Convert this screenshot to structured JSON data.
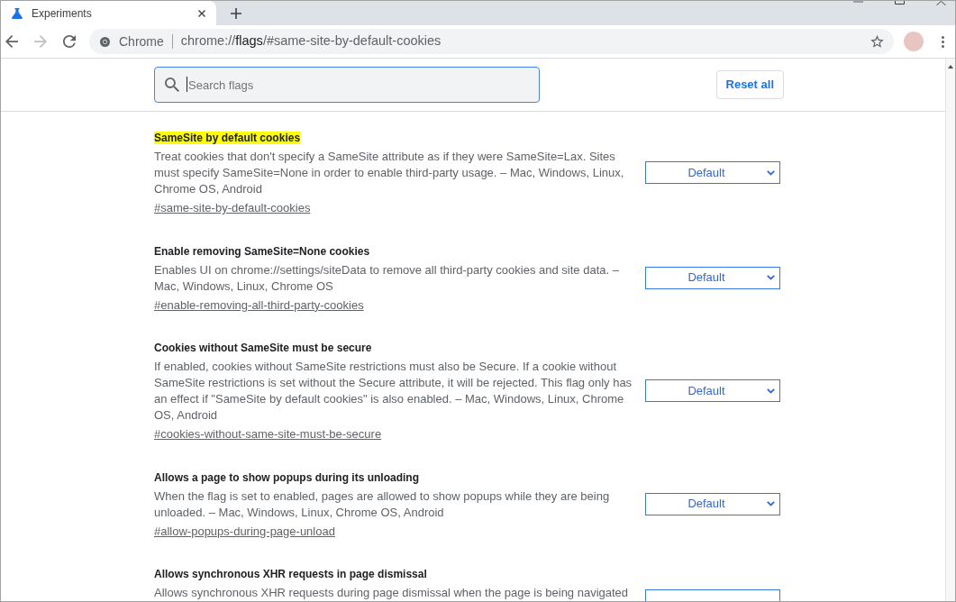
{
  "tabs": [
    {
      "title": "Experiments",
      "selected": true
    }
  ],
  "toolbar": {
    "back": {
      "disabled": false
    },
    "forward": {
      "disabled": true
    },
    "omnibox": {
      "chip": "Chrome",
      "url": {
        "scheme": "chrome://",
        "host": "flags",
        "path": "/#same-site-by-default-cookies"
      }
    }
  },
  "header": {
    "search": {
      "placeholder": "Search flags",
      "focused": true
    },
    "reset_button": "Reset all"
  },
  "flags": [
    {
      "title": "SameSite by default cookies",
      "highlighted": true,
      "description": "Treat cookies that don't specify a SameSite attribute as if they were SameSite=Lax. Sites must specify SameSite=None in order to enable third-party usage. – Mac, Windows, Linux, Chrome OS, Android",
      "link": "#same-site-by-default-cookies",
      "value": "Default"
    },
    {
      "title": "Enable removing SameSite=None cookies",
      "highlighted": false,
      "description": "Enables UI on chrome://settings/siteData to remove all third-party cookies and site data. – Mac, Windows, Linux, Chrome OS",
      "link": "#enable-removing-all-third-party-cookies",
      "value": "Default"
    },
    {
      "title": "Cookies without SameSite must be secure",
      "highlighted": false,
      "description": "If enabled, cookies without SameSite restrictions must also be Secure. If a cookie without SameSite restrictions is set without the Secure attribute, it will be rejected. This flag only has an effect if \"SameSite by default cookies\" is also enabled. – Mac, Windows, Linux, Chrome OS, Android",
      "link": "#cookies-without-same-site-must-be-secure",
      "value": "Default"
    },
    {
      "title": "Allows a page to show popups during its unloading",
      "highlighted": false,
      "description": "When the flag is set to enabled, pages are allowed to show popups while they are being unloaded. – Mac, Windows, Linux, Chrome OS, Android",
      "link": "#allow-popups-during-page-unload",
      "value": "Default"
    },
    {
      "title": "Allows synchronous XHR requests in page dismissal",
      "highlighted": false,
      "description": "Allows synchronous XHR requests during page dismissal when the page is being navigated"
    }
  ]
}
